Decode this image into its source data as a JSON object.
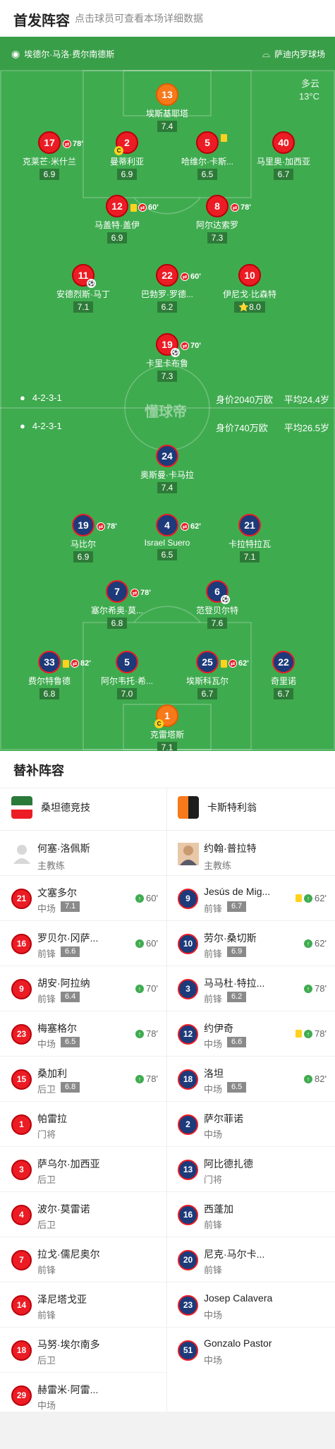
{
  "header": {
    "title": "首发阵容",
    "subtitle": "点击球员可查看本场详细数据"
  },
  "venue": {
    "home_stadium": "埃德尔·马洛·费尔南德斯",
    "away_stadium": "萨迪内罗球场"
  },
  "weather": {
    "condition": "多云",
    "temp": "13°C"
  },
  "home_form": {
    "formation": "4-2-3-1",
    "value": "身价2040万欧",
    "age": "平均24.4岁"
  },
  "away_form": {
    "formation": "4-2-3-1",
    "value": "身价740万欧",
    "age": "平均26.5岁"
  },
  "watermark": "懂球帝",
  "home_players": [
    {
      "num": "13",
      "name": "埃斯基耶塔",
      "rating": "7.4",
      "style": "g"
    },
    {
      "num": "17",
      "name": "克莱芒·米什兰",
      "rating": "6.9",
      "sub": "78'"
    },
    {
      "num": "2",
      "name": "曼蒂利亚",
      "rating": "6.9",
      "captain": "C"
    },
    {
      "num": "5",
      "name": "哈维尔·卡斯...",
      "rating": "6.5",
      "card": "yellow"
    },
    {
      "num": "40",
      "name": "马里奥·加西亚",
      "rating": "6.7"
    },
    {
      "num": "12",
      "name": "马盖特·盖伊",
      "rating": "6.9",
      "sub": "60'",
      "card": "yellow"
    },
    {
      "num": "8",
      "name": "阿尔达索罗",
      "rating": "7.3",
      "sub": "78'"
    },
    {
      "num": "11",
      "name": "安德烈斯·马丁",
      "rating": "7.1",
      "ball": "⚽"
    },
    {
      "num": "22",
      "name": "巴勃罗·罗德...",
      "rating": "6.2",
      "sub": "60'"
    },
    {
      "num": "10",
      "name": "伊尼戈·比森特",
      "rating": "8.0",
      "star": "⭐"
    },
    {
      "num": "19",
      "name": "卡里卡布鲁",
      "rating": "7.3",
      "sub": "70'",
      "ball": "⚽"
    }
  ],
  "away_players": [
    {
      "num": "24",
      "name": "奥斯曼·卡马拉",
      "rating": "7.4"
    },
    {
      "num": "19",
      "name": "马比尔",
      "rating": "6.9",
      "sub": "78'"
    },
    {
      "num": "4",
      "name": "Israel Suero",
      "rating": "6.5",
      "sub": "62'"
    },
    {
      "num": "21",
      "name": "卡拉特拉瓦",
      "rating": "7.1"
    },
    {
      "num": "7",
      "name": "塞尔希奥·莫...",
      "rating": "6.8",
      "sub": "78'"
    },
    {
      "num": "6",
      "name": "范登贝尔特",
      "rating": "7.6",
      "ball": "⚽"
    },
    {
      "num": "33",
      "name": "费尔特鲁德",
      "rating": "6.8",
      "sub": "82'",
      "card": "yellow"
    },
    {
      "num": "5",
      "name": "阿尔韦托·希...",
      "rating": "7.0"
    },
    {
      "num": "25",
      "name": "埃斯科瓦尔",
      "rating": "6.7",
      "sub": "62'",
      "card": "yellow"
    },
    {
      "num": "22",
      "name": "奇里诺",
      "rating": "6.7"
    },
    {
      "num": "1",
      "name": "克雷塔斯",
      "rating": "7.1",
      "captain": "C",
      "style": "g"
    }
  ],
  "subs": {
    "title": "替补阵容",
    "home_team": "桑坦德竞技",
    "away_team": "卡斯特利翁",
    "home_coach": {
      "name": "何塞·洛佩斯",
      "role": "主教练"
    },
    "away_coach": {
      "name": "约翰·普拉特",
      "role": "主教练"
    },
    "home": [
      {
        "num": "21",
        "name": "文塞多尔",
        "pos": "中场",
        "rating": "7.1",
        "on": "60'"
      },
      {
        "num": "16",
        "name": "罗贝尔·冈萨...",
        "pos": "前锋",
        "rating": "6.6",
        "on": "60'"
      },
      {
        "num": "9",
        "name": "胡安·阿拉纳",
        "pos": "前锋",
        "rating": "6.4",
        "on": "70'"
      },
      {
        "num": "23",
        "name": "梅塞格尔",
        "pos": "中场",
        "rating": "6.5",
        "on": "78'"
      },
      {
        "num": "15",
        "name": "桑加利",
        "pos": "后卫",
        "rating": "6.8",
        "on": "78'"
      },
      {
        "num": "1",
        "name": "帕雷拉",
        "pos": "门将"
      },
      {
        "num": "3",
        "name": "萨乌尔·加西亚",
        "pos": "后卫"
      },
      {
        "num": "4",
        "name": "波尔·莫雷诺",
        "pos": "后卫"
      },
      {
        "num": "7",
        "name": "拉戈·儒尼奥尔",
        "pos": "前锋"
      },
      {
        "num": "14",
        "name": "泽尼塔戈亚",
        "pos": "前锋"
      },
      {
        "num": "18",
        "name": "马努·埃尔南多",
        "pos": "后卫"
      },
      {
        "num": "29",
        "name": "赫雷米·阿雷...",
        "pos": "中场"
      }
    ],
    "away": [
      {
        "num": "9",
        "name": "Jesús de Mig...",
        "pos": "前锋",
        "rating": "6.7",
        "on": "62'",
        "card": "yellow"
      },
      {
        "num": "10",
        "name": "劳尔·桑切斯",
        "pos": "前锋",
        "rating": "6.9",
        "on": "62'"
      },
      {
        "num": "3",
        "name": "马马杜·特拉...",
        "pos": "前锋",
        "rating": "6.2",
        "on": "78'"
      },
      {
        "num": "12",
        "name": "约伊奇",
        "pos": "中场",
        "rating": "6.6",
        "on": "78'",
        "card": "yellow"
      },
      {
        "num": "18",
        "name": "洛坦",
        "pos": "中场",
        "rating": "6.5",
        "on": "82'"
      },
      {
        "num": "2",
        "name": "萨尔菲诺",
        "pos": "中场"
      },
      {
        "num": "13",
        "name": "阿比德扎德",
        "pos": "门将"
      },
      {
        "num": "16",
        "name": "西蓬加",
        "pos": "前锋"
      },
      {
        "num": "20",
        "name": "尼克·马尔卡...",
        "pos": "前锋"
      },
      {
        "num": "23",
        "name": "Josep Calavera",
        "pos": "中场"
      },
      {
        "num": "51",
        "name": "Gonzalo Pastor",
        "pos": "中场"
      }
    ]
  },
  "colors": {
    "pitch": "#3fab4f",
    "home": "#ec1c24",
    "away": "#1d3a7a",
    "gk": "#f7791a",
    "sub_arrow": "#3fab4f",
    "card": "#ffd21e"
  }
}
